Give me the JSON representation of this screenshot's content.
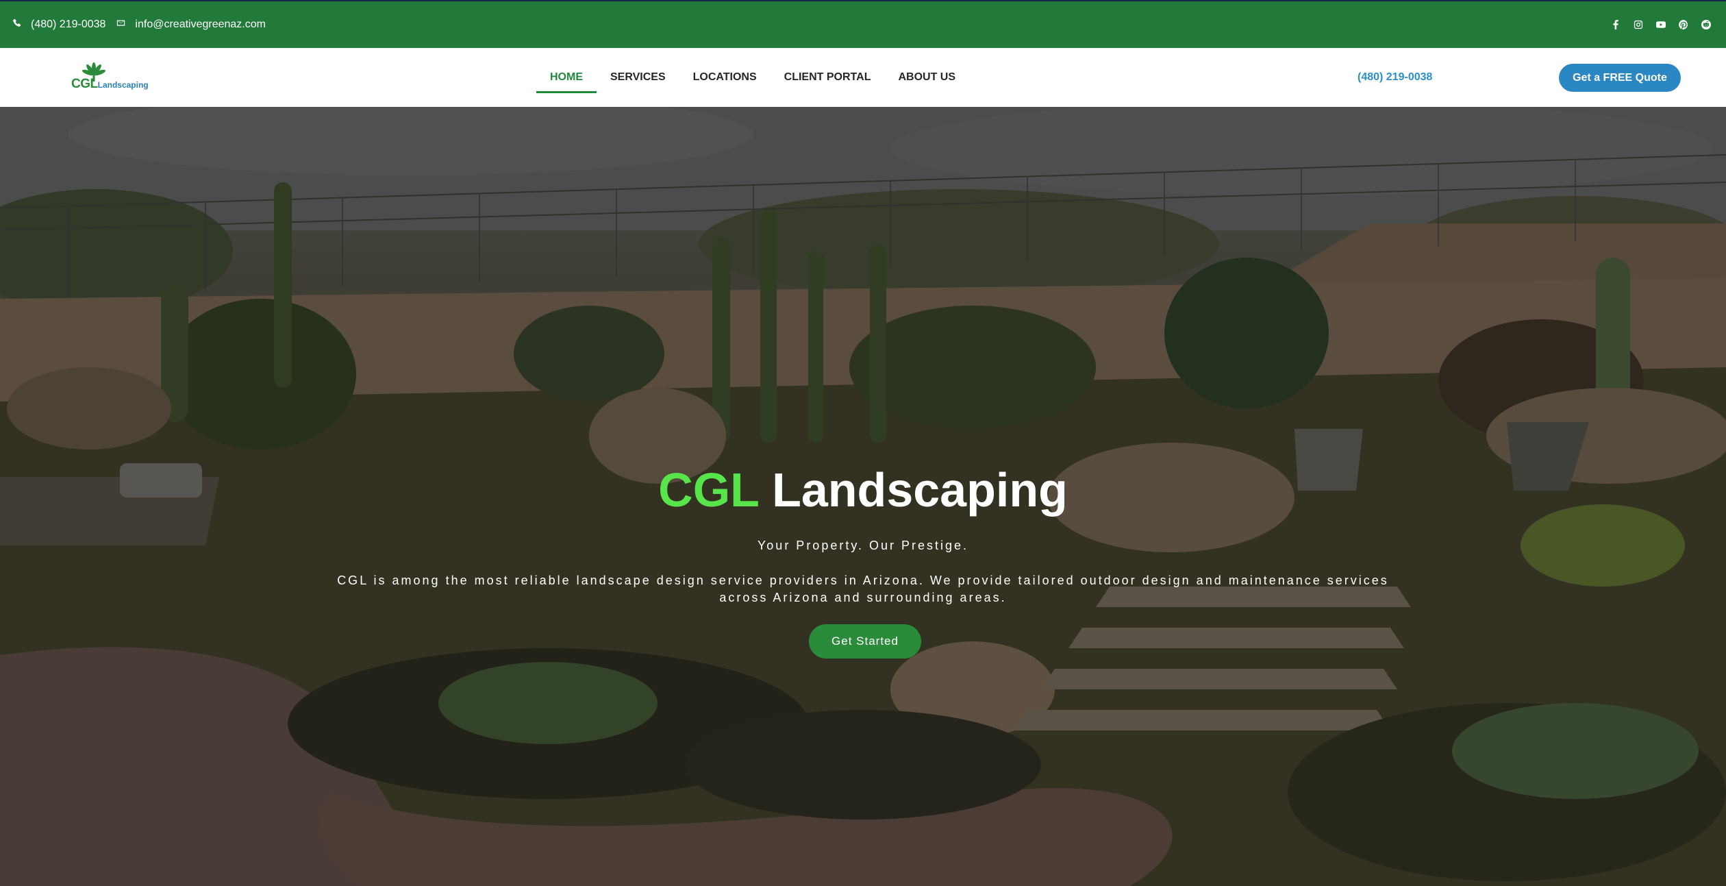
{
  "topbar": {
    "phone": "(480) 219-0038",
    "email": "info@creativegreenaz.com",
    "social": [
      "facebook-icon",
      "instagram-icon",
      "youtube-icon",
      "pinterest-icon",
      "reddit-icon"
    ],
    "background_color": "#227a3a"
  },
  "header": {
    "logo": {
      "cgl": "CGL",
      "text": "Landscaping"
    },
    "nav": [
      {
        "label": "HOME",
        "active": true
      },
      {
        "label": "SERVICES",
        "active": false
      },
      {
        "label": "LOCATIONS",
        "active": false
      },
      {
        "label": "CLIENT PORTAL",
        "active": false
      },
      {
        "label": "ABOUT US",
        "active": false
      }
    ],
    "phone": "(480) 219-0038",
    "quote_button": "Get a FREE Quote",
    "accent_color": "#1f8a3b",
    "button_color": "#2a87c3"
  },
  "hero": {
    "title_accent": "CGL",
    "title_rest": "Landscaping",
    "tagline": "Your Property. Our Prestige.",
    "description": "CGL is among the most reliable landscape design service providers in Arizona. We provide tailored outdoor design and maintenance services across Arizona and surrounding areas.",
    "cta": "Get Started",
    "accent_color": "#58e54b"
  }
}
